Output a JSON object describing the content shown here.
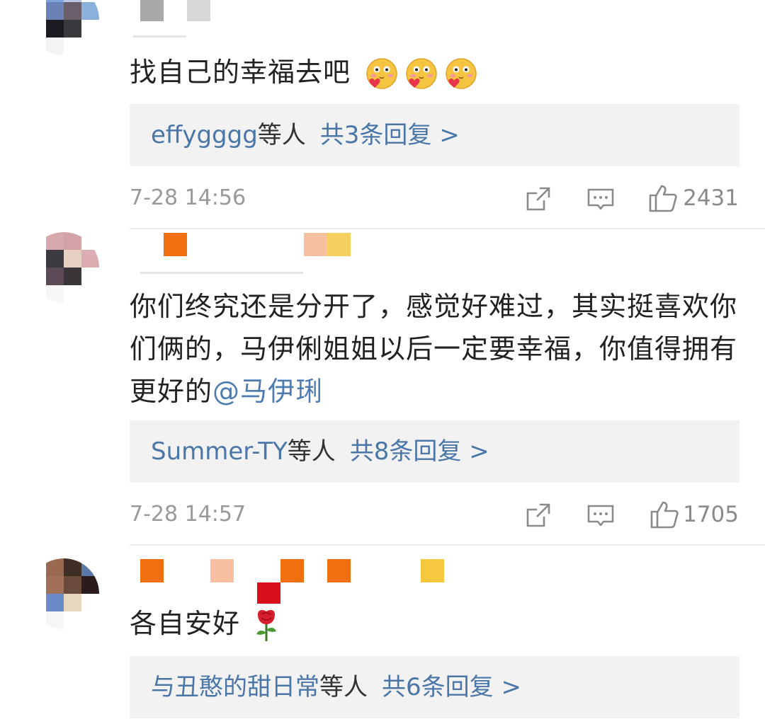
{
  "comments": [
    {
      "text": "找自己的幸福去吧",
      "reply_users": "effygggg",
      "reply_by": "等人",
      "reply_count": "共3条回复 >",
      "time": "7-28 14:56",
      "likes": "2431",
      "emoji_names": [
        "blush-heart-emoji",
        "blush-heart-emoji",
        "blush-heart-emoji"
      ]
    },
    {
      "text_part1": "你们终究还是分开了，感觉好难过，其实挺喜欢你们俩的，马伊俐姐姐以后一定要幸福，你值得拥有更好的",
      "mention": "@马伊琍",
      "reply_users": "Summer-TY",
      "reply_by": "等人",
      "reply_count": "共8条回复 >",
      "time": "7-28 14:57",
      "likes": "1705"
    },
    {
      "text": "各自安好",
      "emoji_names": [
        "rose-emoji"
      ],
      "reply_users": "与丑憨的甜日常",
      "reply_by": "等人",
      "reply_count": "共6条回复 >"
    }
  ],
  "icons": {
    "share": "share-icon",
    "comment": "comment-icon",
    "like": "thumbs-up-icon"
  },
  "colors": {
    "link": "#4a76a8",
    "reply_bg": "#f2f2f2",
    "meta_gray": "#999999"
  }
}
